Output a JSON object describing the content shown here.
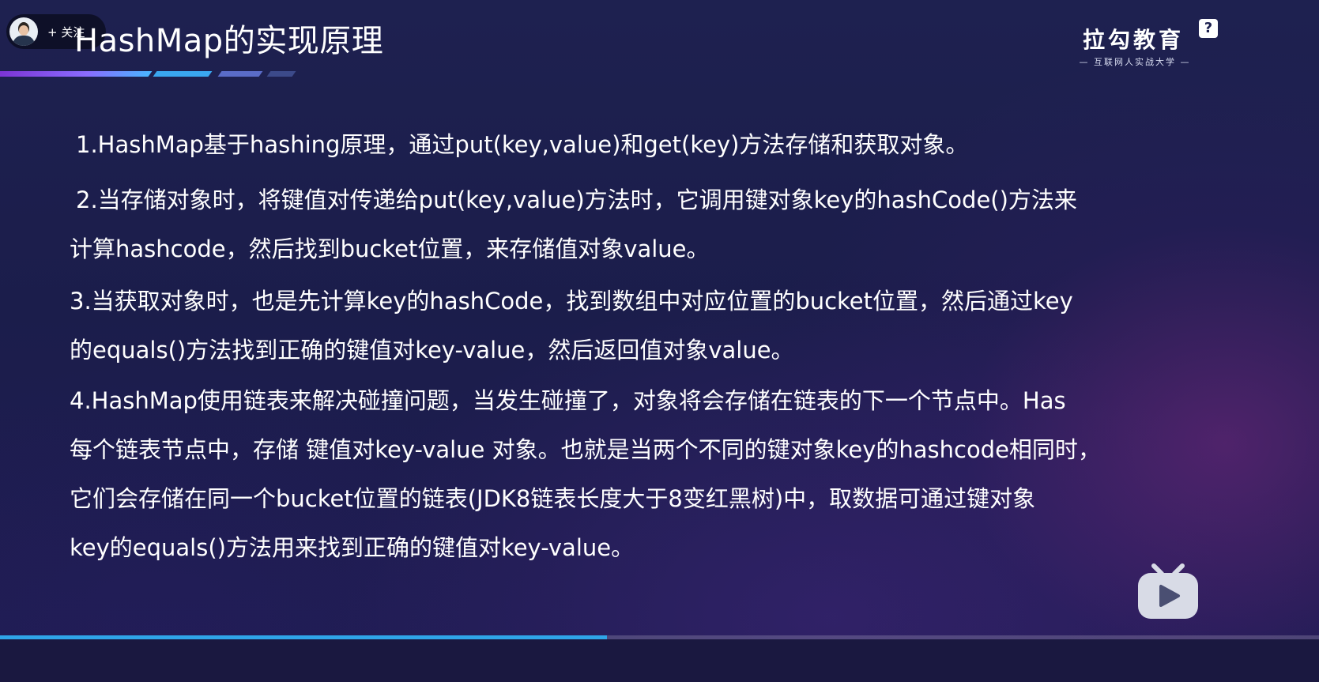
{
  "slide": {
    "title": "HashMap的实现原理",
    "paragraphs": [
      [
        "1.HashMap基于hashing原理，通过put(key,value)和get(key)方法存储和获取对象。"
      ],
      [
        "2.当存储对象时，将键值对传递给put(key,value)方法时，它调用键对象key的hashCode()方法来",
        "计算hashcode，然后找到bucket位置，来存储值对象value。"
      ],
      [
        "3.当获取对象时，也是先计算key的hashCode，找到数组中对应位置的bucket位置，然后通过key",
        "的equals()方法找到正确的键值对key-value，然后返回值对象value。"
      ],
      [
        "4.HashMap使用链表来解决碰撞问题，当发生碰撞了，对象将会存储在链表的下一个节点中。Has",
        "每个链表节点中，存储 键值对key-value 对象。也就是当两个不同的键对象key的hashcode相同时，",
        "它们会存储在同一个bucket位置的链表(JDK8链表长度大于8变红黑树)中，取数据可通过键对象",
        "key的equals()方法用来找到正确的键值对key-value。"
      ]
    ]
  },
  "uploader": {
    "follow_label": "+ 关注",
    "avatar_icon": "person-avatar"
  },
  "logo": {
    "name": "拉勾教育",
    "tagline": "— 互联网人实战大学 —"
  },
  "help": {
    "label": "?"
  },
  "player": {
    "progress": 0.46,
    "progress_color": "#2fa5e8",
    "tv_icon": "bilibili-tv-icon"
  },
  "colors": {
    "background": "#1e2150",
    "text": "#ffffff",
    "accent": "#3aa7f0"
  }
}
